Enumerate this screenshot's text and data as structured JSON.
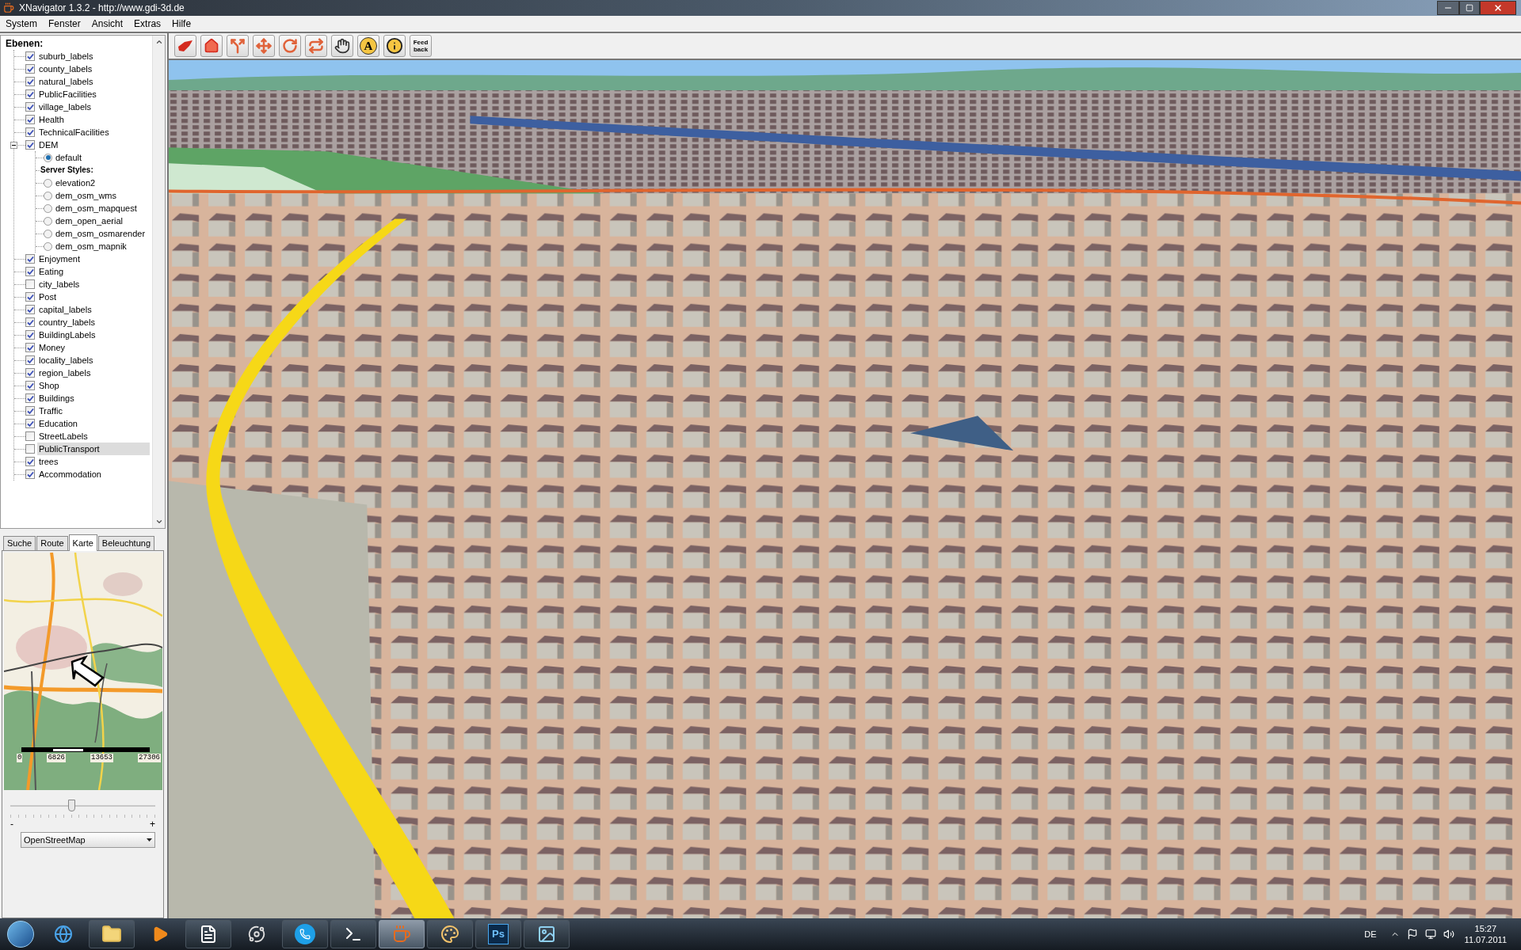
{
  "window": {
    "title": "XNavigator 1.3.2 - http://www.gdi-3d.de"
  },
  "menu": [
    "System",
    "Fenster",
    "Ansicht",
    "Extras",
    "Hilfe"
  ],
  "layers": {
    "title": "Ebenen:",
    "items": [
      {
        "label": "suburb_labels",
        "checked": true,
        "selected": false
      },
      {
        "label": "county_labels",
        "checked": true,
        "selected": false
      },
      {
        "label": "natural_labels",
        "checked": true,
        "selected": false
      },
      {
        "label": "PublicFacilities",
        "checked": true,
        "selected": false
      },
      {
        "label": "village_labels",
        "checked": true,
        "selected": false
      },
      {
        "label": "Health",
        "checked": true,
        "selected": false
      },
      {
        "label": "TechnicalFacilities",
        "checked": true,
        "selected": false
      },
      {
        "label": "DEM",
        "checked": true,
        "selected": false,
        "expanded": true,
        "children": [
          {
            "kind": "radio",
            "label": "default",
            "selected": true
          },
          {
            "kind": "header",
            "label": "Server Styles:"
          },
          {
            "kind": "radio",
            "label": "elevation2",
            "selected": false
          },
          {
            "kind": "radio",
            "label": "dem_osm_wms",
            "selected": false
          },
          {
            "kind": "radio",
            "label": "dem_osm_mapquest",
            "selected": false
          },
          {
            "kind": "radio",
            "label": "dem_open_aerial",
            "selected": false
          },
          {
            "kind": "radio",
            "label": "dem_osm_osmarender",
            "selected": false
          },
          {
            "kind": "radio",
            "label": "dem_osm_mapnik",
            "selected": false
          }
        ]
      },
      {
        "label": "Enjoyment",
        "checked": true,
        "selected": false
      },
      {
        "label": "Eating",
        "checked": true,
        "selected": false
      },
      {
        "label": "city_labels",
        "checked": false,
        "selected": false
      },
      {
        "label": "Post",
        "checked": true,
        "selected": false
      },
      {
        "label": "capital_labels",
        "checked": true,
        "selected": false
      },
      {
        "label": "country_labels",
        "checked": true,
        "selected": false
      },
      {
        "label": "BuildingLabels",
        "checked": true,
        "selected": false
      },
      {
        "label": "Money",
        "checked": true,
        "selected": false
      },
      {
        "label": "locality_labels",
        "checked": true,
        "selected": false
      },
      {
        "label": "region_labels",
        "checked": true,
        "selected": false
      },
      {
        "label": "Shop",
        "checked": true,
        "selected": false
      },
      {
        "label": "Buildings",
        "checked": true,
        "selected": false
      },
      {
        "label": "Traffic",
        "checked": true,
        "selected": false
      },
      {
        "label": "Education",
        "checked": true,
        "selected": false
      },
      {
        "label": "StreetLabels",
        "checked": false,
        "selected": false
      },
      {
        "label": "PublicTransport",
        "checked": false,
        "selected": true
      },
      {
        "label": "trees",
        "checked": true,
        "selected": false
      },
      {
        "label": "Accommodation",
        "checked": true,
        "selected": false
      }
    ]
  },
  "tabs": [
    {
      "label": "Suche",
      "selected": false
    },
    {
      "label": "Route",
      "selected": false
    },
    {
      "label": "Karte",
      "selected": true
    },
    {
      "label": "Beleuchtung",
      "selected": false
    }
  ],
  "minimap": {
    "scale_labels": [
      "0",
      "6826",
      "13653",
      "27306"
    ],
    "zoom": {
      "level": 0.42,
      "min_label": "-",
      "max_label": "+"
    },
    "layer_select": "OpenStreetMap"
  },
  "toolbar": {
    "text_tool": "A",
    "feedback": "Feed back"
  },
  "taskbar": {
    "ps_label": "Ps"
  },
  "tray": {
    "language": "DE",
    "time": "15:27",
    "date": "11.07.2011"
  }
}
